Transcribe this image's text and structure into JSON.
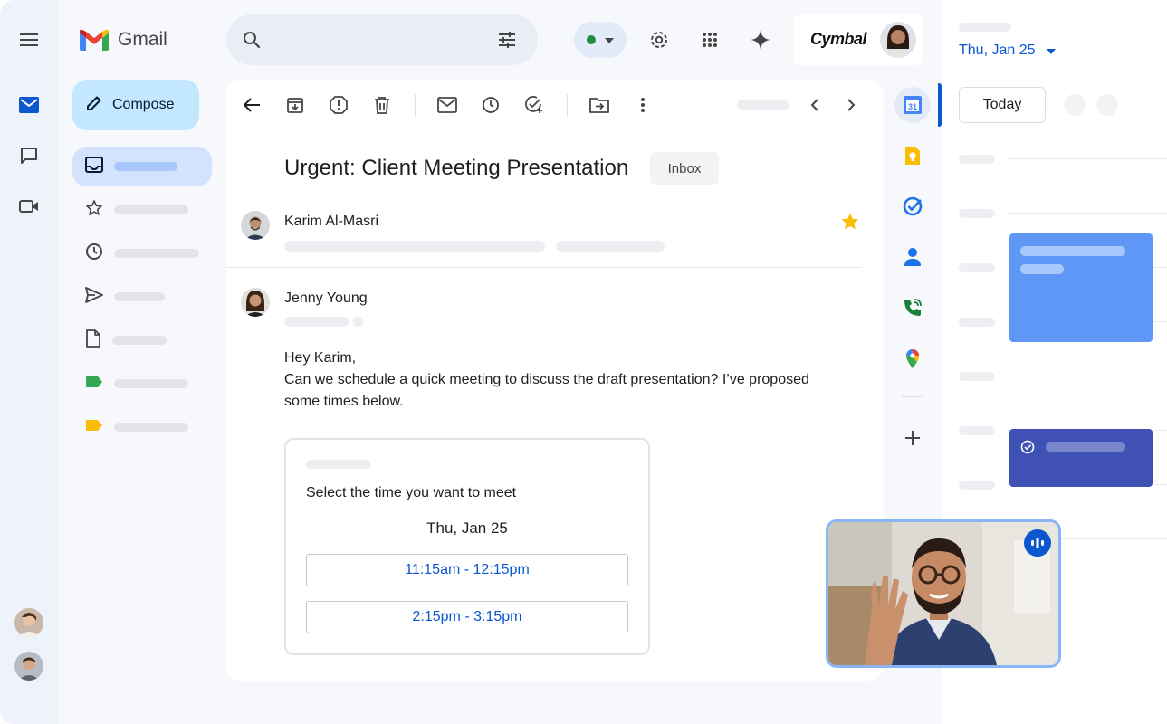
{
  "app": {
    "name": "Gmail"
  },
  "brand": {
    "name": "Cymbal"
  },
  "compose": {
    "label": "Compose"
  },
  "email": {
    "subject": "Urgent: Client Meeting Presentation",
    "label_chip": "Inbox",
    "starred": true,
    "messages": [
      {
        "sender": "Karim Al-Masri"
      },
      {
        "sender": "Jenny Young"
      }
    ],
    "body": {
      "greeting": "Hey Karim,",
      "text": "Can we schedule a quick meeting to discuss the draft presentation? I’ve proposed some times below."
    }
  },
  "scheduler": {
    "title": "Select the time you want to meet",
    "date": "Thu, Jan 25",
    "slots": [
      "11:15am - 12:15pm",
      "2:15pm - 3:15pm"
    ]
  },
  "calendar": {
    "date": "Thu, Jan 25",
    "today_label": "Today"
  },
  "colors": {
    "accent": "#0b57d0",
    "compose_bg": "#c2e7ff",
    "event_primary": "#5e97f6",
    "event_task": "#3f51b5",
    "label_green": "#34a853",
    "label_yellow": "#fbbc04",
    "star": "#fbbc04"
  },
  "icons": {
    "rail": [
      "menu-icon",
      "mail-icon",
      "chat-icon",
      "meet-icon"
    ],
    "toolbar": [
      "back-arrow-icon",
      "archive-icon",
      "report-spam-icon",
      "delete-icon",
      "mark-unread-icon",
      "snooze-icon",
      "add-task-icon",
      "move-to-icon",
      "more-vert-icon",
      "chevron-left-icon",
      "chevron-right-icon"
    ],
    "side_apps": [
      "calendar-app-icon",
      "keep-app-icon",
      "tasks-app-icon",
      "contacts-app-icon",
      "voice-app-icon",
      "maps-app-icon",
      "add-icon"
    ]
  }
}
